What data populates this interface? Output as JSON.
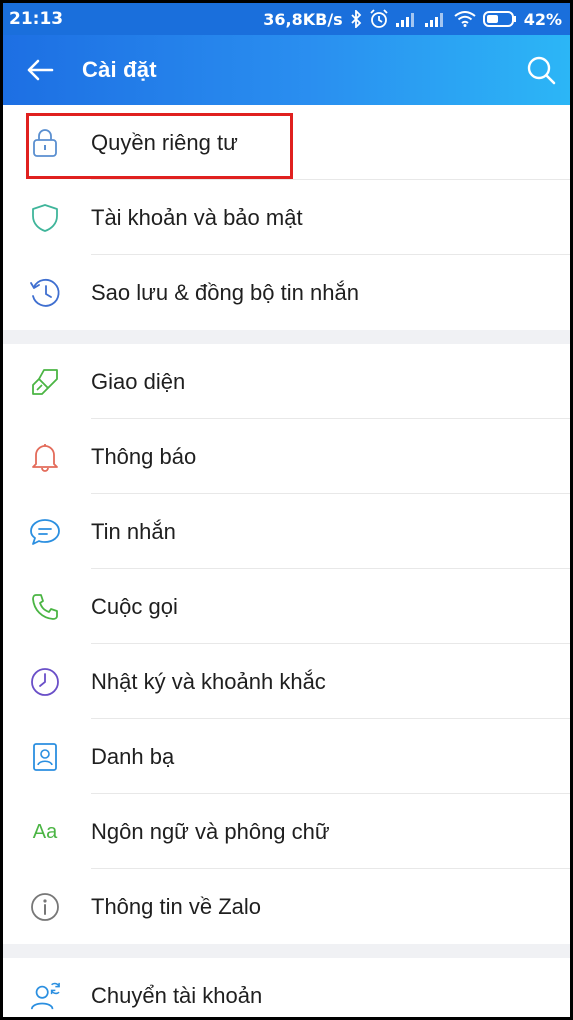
{
  "status_bar": {
    "time": "21:13",
    "network_speed": "36,8KB/s",
    "battery": "42%"
  },
  "app_bar": {
    "title": "Cài đặt"
  },
  "settings": {
    "section1": [
      {
        "label": "Quyền riêng tư",
        "icon": "lock-icon",
        "color": "#5a8fd0"
      },
      {
        "label": "Tài khoản và bảo mật",
        "icon": "shield-icon",
        "color": "#3fb59a"
      },
      {
        "label": "Sao lưu & đồng bộ tin nhắn",
        "icon": "history-clock-icon",
        "color": "#3f6fd0"
      }
    ],
    "section2": [
      {
        "label": "Giao diện",
        "icon": "paint-brush-icon",
        "color": "#4bb544"
      },
      {
        "label": "Thông báo",
        "icon": "bell-icon",
        "color": "#e36b5a"
      },
      {
        "label": "Tin nhắn",
        "icon": "chat-bubble-icon",
        "color": "#2b8fe0"
      },
      {
        "label": "Cuộc gọi",
        "icon": "phone-icon",
        "color": "#4bb544"
      },
      {
        "label": "Nhật ký và khoảnh khắc",
        "icon": "clock-icon",
        "color": "#6a4fc8"
      },
      {
        "label": "Danh bạ",
        "icon": "contact-card-icon",
        "color": "#2b8fe0"
      },
      {
        "label": "Ngôn ngữ và phông chữ",
        "icon": "font-icon",
        "icon_text": "Aa",
        "color": "#4bb544"
      },
      {
        "label": "Thông tin về Zalo",
        "icon": "info-icon",
        "color": "#777777"
      }
    ],
    "section3": [
      {
        "label": "Chuyển tài khoản",
        "icon": "switch-account-icon",
        "color": "#2b8fe0"
      }
    ]
  },
  "colors": {
    "app_bar_start": "#1d6fe3",
    "app_bar_end": "#2cb6f6",
    "highlight_border": "#e0201f"
  }
}
